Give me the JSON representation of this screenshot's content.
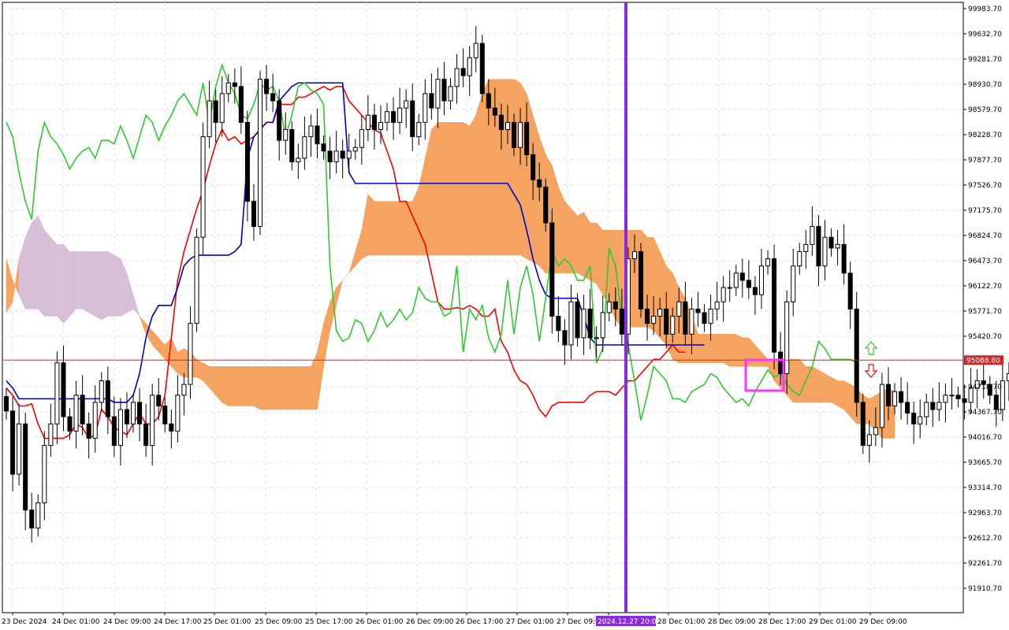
{
  "chart_data": {
    "type": "candlestick",
    "y_axis": {
      "ticks": [
        "99983.70",
        "99632.70",
        "99281.70",
        "98930.70",
        "98579.70",
        "98228.70",
        "97877.70",
        "97526.70",
        "97175.70",
        "96824.70",
        "96473.70",
        "96122.70",
        "95771.70",
        "95420.70",
        "95069.70",
        "94718.70",
        "94367.70",
        "94016.70",
        "93665.70",
        "93314.70",
        "92963.70",
        "92612.70",
        "92261.70",
        "91910.70"
      ],
      "range": [
        91700,
        100050
      ]
    },
    "x_axis": {
      "ticks": [
        "23 Dec 2024",
        "24 Dec 01:00",
        "24 Dec 09:00",
        "24 Dec 17:00",
        "25 Dec 01:00",
        "25 Dec 09:00",
        "25 Dec 17:00",
        "26 Dec 01:00",
        "26 Dec 09:00",
        "26 Dec 17:00",
        "27 Dec 01:00",
        "27 Dec 09:00",
        "2024.12.27 20:00",
        "28 Dec 01:00",
        "28 Dec 09:00",
        "28 Dec 17:00",
        "29 Dec 01:00",
        "29 Dec 09:00"
      ],
      "highlight_label": "2024.12.27 20:00",
      "bars_per_tick": 8
    },
    "current_price": "95088.80",
    "bars": {
      "count": 166,
      "close": [
        94380,
        93500,
        94200,
        93000,
        92750,
        93100,
        93900,
        94200,
        95050,
        94300,
        94100,
        94600,
        94200,
        94000,
        94500,
        94800,
        94300,
        93900,
        94400,
        94200,
        94500,
        94200,
        93900,
        94600,
        94450,
        94200,
        94100,
        94600,
        94750,
        95600,
        96800,
        98200,
        98700,
        98400,
        98800,
        98950,
        98900,
        98400,
        97300,
        96950,
        99000,
        98800,
        98700,
        98150,
        98300,
        97850,
        97900,
        98200,
        98350,
        98100,
        98000,
        97850,
        98000,
        97900,
        98000,
        98050,
        98300,
        98500,
        98300,
        98400,
        98550,
        98400,
        98600,
        98700,
        98200,
        98400,
        98800,
        98600,
        99000,
        98700,
        98900,
        99150,
        99050,
        99300,
        99500,
        98800,
        98600,
        98500,
        98300,
        98400,
        98050,
        98400,
        97950,
        97600,
        97500,
        97000,
        95700,
        95500,
        95300,
        95900,
        95400,
        95800,
        95400,
        95400,
        95750,
        95900,
        95800,
        95450,
        96500,
        96600,
        95800,
        95600,
        95700,
        95800,
        95450,
        95700,
        95900,
        95450,
        95800,
        95750,
        95600,
        95800,
        95900,
        96100,
        96100,
        96300,
        96200,
        96100,
        96000,
        96400,
        96500,
        95200,
        94900,
        95900,
        96400,
        96600,
        96700,
        96950,
        96400,
        96800,
        96650,
        96700,
        96300,
        95800,
        94500,
        93900,
        94050,
        94150,
        94750,
        94450,
        94650,
        94500,
        94350,
        94200,
        94300,
        94500,
        94400,
        94500,
        94600,
        94600,
        94550,
        94500,
        94700,
        94800,
        94750,
        94600,
        94400,
        94800,
        94900,
        94950,
        94800,
        95100,
        95150,
        95300,
        95200,
        95100,
        95050,
        95050,
        95100,
        95100,
        95050,
        95150,
        95100,
        95050
      ],
      "open_close_highs_lows_note": ""
    },
    "series": [
      {
        "role": "tenkan",
        "color": "#ff0000",
        "values": [
          94700,
          94600,
          94450,
          94450,
          94480,
          94200,
          94000,
          94000,
          94000,
          94000,
          94050,
          94200,
          94150,
          94000,
          94050,
          94400,
          94300,
          94150,
          94100,
          94050,
          94200,
          94350,
          94200,
          94200,
          94300,
          94600,
          95400,
          96200,
          96600,
          96900,
          97200,
          97450,
          97800,
          98100,
          98300,
          98150,
          98200,
          98100,
          98150,
          98200,
          98300,
          98400,
          98400,
          98650,
          98650,
          98650,
          98750,
          98750,
          98800,
          98850,
          98900,
          98850,
          98900,
          98900,
          98700,
          98600,
          98500,
          98400,
          98300,
          98250,
          98000,
          97750,
          97300,
          97300,
          97100,
          96900,
          96700,
          96300,
          95900,
          95800,
          95800,
          95820,
          95800,
          95850,
          95800,
          95700,
          95700,
          95800,
          95350,
          95200,
          94950,
          94800,
          94750,
          94600,
          94400,
          94300,
          94450,
          94500,
          94500,
          94500,
          94500,
          94500,
          94600,
          94650,
          94650,
          94650,
          94600,
          94700,
          94800,
          94800,
          94900,
          95000,
          95100,
          95100,
          95200,
          95300,
          95200,
          95200
        ]
      },
      {
        "role": "kijun",
        "color": "#0000c8",
        "values": [
          94800,
          94700,
          94550,
          94550,
          94550,
          94550,
          94550,
          94550,
          94550,
          94550,
          94550,
          94550,
          94550,
          94550,
          94550,
          94550,
          94550,
          94500,
          94500,
          94500,
          94600,
          94900,
          95400,
          95700,
          95850,
          95850,
          95850,
          96100,
          96400,
          96500,
          96550,
          96550,
          96550,
          96550,
          96550,
          96550,
          96600,
          96700,
          97900,
          98200,
          98300,
          98400,
          98400,
          98700,
          98800,
          98900,
          98950,
          98950,
          98950,
          98950,
          98950,
          98950,
          98950,
          98950,
          97700,
          97550,
          97550,
          97550,
          97550,
          97550,
          97550,
          97550,
          97550,
          97550,
          97550,
          97550,
          97550,
          97550,
          97550,
          97550,
          97550,
          97550,
          97550,
          97550,
          97550,
          97550,
          97550,
          97550,
          97550,
          97550,
          97400,
          97250,
          96900,
          96500,
          96200,
          96000,
          95950,
          95950,
          95950,
          95950,
          95950,
          95700,
          95400,
          95300,
          95300,
          95300,
          95300,
          95300,
          95300,
          95300,
          95300,
          95300,
          95300,
          95300,
          95300,
          95300,
          95300,
          95300,
          95300,
          95300,
          95300
        ]
      },
      {
        "role": "chikou",
        "color": "#32c832",
        "values": [
          98400,
          98200,
          97700,
          97300,
          97050,
          98000,
          98400,
          98200,
          98100,
          97950,
          97750,
          97900,
          98000,
          98050,
          97900,
          98150,
          98150,
          98100,
          98350,
          98150,
          97900,
          98200,
          98500,
          98400,
          98150,
          98350,
          98500,
          98700,
          98800,
          98650,
          98500,
          98950,
          98400,
          98900,
          99200,
          98950,
          98800,
          98500,
          98450,
          98650,
          98950,
          98850,
          98900,
          98700,
          98200,
          98500,
          98900,
          98950,
          98850,
          98800,
          98650,
          96400,
          95500,
          95350,
          95400,
          95650,
          95600,
          95350,
          95500,
          95750,
          95550,
          95650,
          95800,
          95650,
          95750,
          96100,
          95950,
          95900,
          95900,
          95700,
          95750,
          96400,
          95200,
          95800,
          95650,
          95850,
          95400,
          95200,
          95450,
          96200,
          95450,
          96100,
          96400,
          96000,
          95350,
          95950,
          96600,
          96400,
          96500,
          96400,
          96200,
          96200,
          96400,
          95050,
          95250,
          96650,
          96400,
          95650,
          95300,
          94800,
          94250,
          94600,
          95000,
          94900,
          94800,
          94550,
          94550,
          94500,
          94650,
          94700,
          94750,
          94900,
          94850,
          94700,
          94600,
          94500,
          94550,
          94450,
          94650,
          94800,
          94950,
          94850,
          94900,
          94750,
          94650,
          94600,
          94800,
          95000,
          95350,
          95250,
          95100,
          95100,
          95100,
          95100,
          95050
        ]
      },
      {
        "role": "senkou_a",
        "color": "#f4a460",
        "values": [
          96500,
          96200,
          96000,
          95800,
          95800,
          95800,
          95700,
          95700,
          95700,
          95600,
          95700,
          95800,
          95800,
          95750,
          95700,
          95650,
          95700,
          95700,
          95700,
          95750,
          95800,
          95700,
          95600,
          95500,
          95400,
          95300,
          95400,
          95200,
          95250,
          95200,
          95100,
          95050,
          95000,
          95000,
          95000,
          95000,
          95000,
          95000,
          95000,
          95000,
          95000,
          95000,
          95000,
          95000,
          95000,
          95000,
          95000,
          95000,
          95000,
          95200,
          95600,
          95900,
          96100,
          96200,
          96300,
          96600,
          96900,
          97400,
          97300,
          97300,
          97300,
          97300,
          97300,
          97300,
          97300,
          97500,
          97900,
          98300,
          98400,
          98400,
          98400,
          98400,
          98400,
          98350,
          98500,
          98800,
          99000,
          99000,
          99000,
          99000,
          99000,
          98950,
          98800,
          98500,
          98200,
          97950,
          97800,
          97500,
          97300,
          97200,
          97100,
          97150,
          97000,
          97000,
          96900,
          96900,
          96900,
          96900,
          96900,
          96900,
          96900,
          96800,
          96800,
          96600,
          96400,
          96300,
          96100,
          95950,
          95700,
          95450,
          95450,
          95450,
          95450,
          95450,
          95450,
          95450,
          95400,
          95400,
          95300,
          95200,
          95100,
          95100,
          95100,
          95100,
          95100,
          95100,
          95000,
          95000,
          94950,
          94900,
          94850,
          94800,
          94800,
          94750,
          94700,
          94600,
          94550,
          94600,
          94650,
          94700,
          94650
        ]
      },
      {
        "role": "senkou_b",
        "color": "#d8bfd8",
        "values": [
          95750,
          95900,
          96500,
          96800,
          97000,
          97100,
          96900,
          96800,
          96700,
          96700,
          96600,
          96600,
          96600,
          96600,
          96600,
          96600,
          96600,
          96550,
          96500,
          96300,
          96000,
          95700,
          95450,
          95300,
          95200,
          95100,
          95000,
          94900,
          94850,
          94850,
          94850,
          94800,
          94700,
          94600,
          94500,
          94450,
          94450,
          94450,
          94450,
          94450,
          94400,
          94400,
          94400,
          94400,
          94400,
          94400,
          94400,
          94400,
          94400,
          94400,
          95000,
          95500,
          95850,
          96200,
          96300,
          96400,
          96500,
          96550,
          96550,
          96550,
          96550,
          96550,
          96550,
          96550,
          96550,
          96550,
          96550,
          96550,
          96550,
          96550,
          96550,
          96550,
          96550,
          96550,
          96550,
          96550,
          96550,
          96550,
          96550,
          96550,
          96550,
          96550,
          96500,
          96450,
          96400,
          96300,
          96300,
          96300,
          96300,
          96300,
          96300,
          96250,
          96200,
          96150,
          96000,
          95850,
          95650,
          95550,
          95550,
          95550,
          95550,
          95550,
          95500,
          95400,
          95300,
          95100,
          95050,
          95050,
          95050,
          95050,
          95050,
          95050,
          95050,
          95050,
          95000,
          95000,
          95000,
          95000,
          95000,
          95000,
          95000,
          94800,
          94700,
          94600,
          94500,
          94500,
          94500,
          94500,
          94500,
          94500,
          94500,
          94450,
          94400,
          94300,
          94200,
          94200,
          94200,
          94100,
          94000,
          94000,
          94000,
          94000
        ]
      }
    ],
    "ichimoku_note": "",
    "vertical_line_color": "#8a2be2",
    "price_line_color": "#d22828",
    "highlight_box_color": "#ff33ff",
    "signal_colors": {
      "up": "#55cc55",
      "down": "#dd3333"
    },
    "grid": true
  }
}
